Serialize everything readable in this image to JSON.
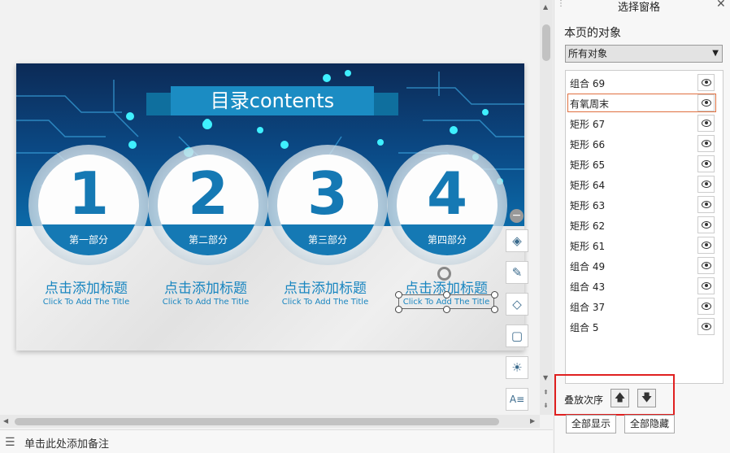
{
  "slide": {
    "title": "目录contents",
    "sections": [
      {
        "number": "1",
        "part": "第一部分",
        "title": "点击添加标题",
        "subtitle": "Click To Add The Title"
      },
      {
        "number": "2",
        "part": "第二部分",
        "title": "点击添加标题",
        "subtitle": "Click To Add The Title"
      },
      {
        "number": "3",
        "part": "第三部分",
        "title": "点击添加标题",
        "subtitle": "Click To Add The Title"
      },
      {
        "number": "4",
        "part": "第四部分",
        "title": "点击添加标题",
        "subtitle": "Click To Add The Title"
      }
    ]
  },
  "floating_tools": [
    {
      "icon": "layers-icon",
      "glyph": "◈"
    },
    {
      "icon": "brush-icon",
      "glyph": "✎"
    },
    {
      "icon": "fill-icon",
      "glyph": "◇"
    },
    {
      "icon": "frame-icon",
      "glyph": "▢"
    },
    {
      "icon": "bulb-icon",
      "glyph": "☀"
    },
    {
      "icon": "text-style-icon",
      "glyph": "A≡"
    }
  ],
  "notes": {
    "placeholder": "单击此处添加备注"
  },
  "pane": {
    "title": "选择窗格",
    "section_label": "本页的对象",
    "filter_value": "所有对象",
    "objects": [
      {
        "label": "组合 69",
        "selected": false
      },
      {
        "label": "有氧周末",
        "selected": true
      },
      {
        "label": "矩形 67",
        "selected": false
      },
      {
        "label": "矩形 66",
        "selected": false
      },
      {
        "label": "矩形 65",
        "selected": false
      },
      {
        "label": "矩形 64",
        "selected": false
      },
      {
        "label": "矩形 63",
        "selected": false
      },
      {
        "label": "矩形 62",
        "selected": false
      },
      {
        "label": "矩形 61",
        "selected": false
      },
      {
        "label": "组合 49",
        "selected": false
      },
      {
        "label": "组合 43",
        "selected": false
      },
      {
        "label": "组合 37",
        "selected": false
      },
      {
        "label": "组合 5",
        "selected": false
      }
    ],
    "order_label": "叠放次序",
    "show_all": "全部显示",
    "hide_all": "全部隐藏"
  },
  "colors": {
    "accent": "#1579b4",
    "highlight": "#e02020",
    "selected_border": "#e07040"
  }
}
